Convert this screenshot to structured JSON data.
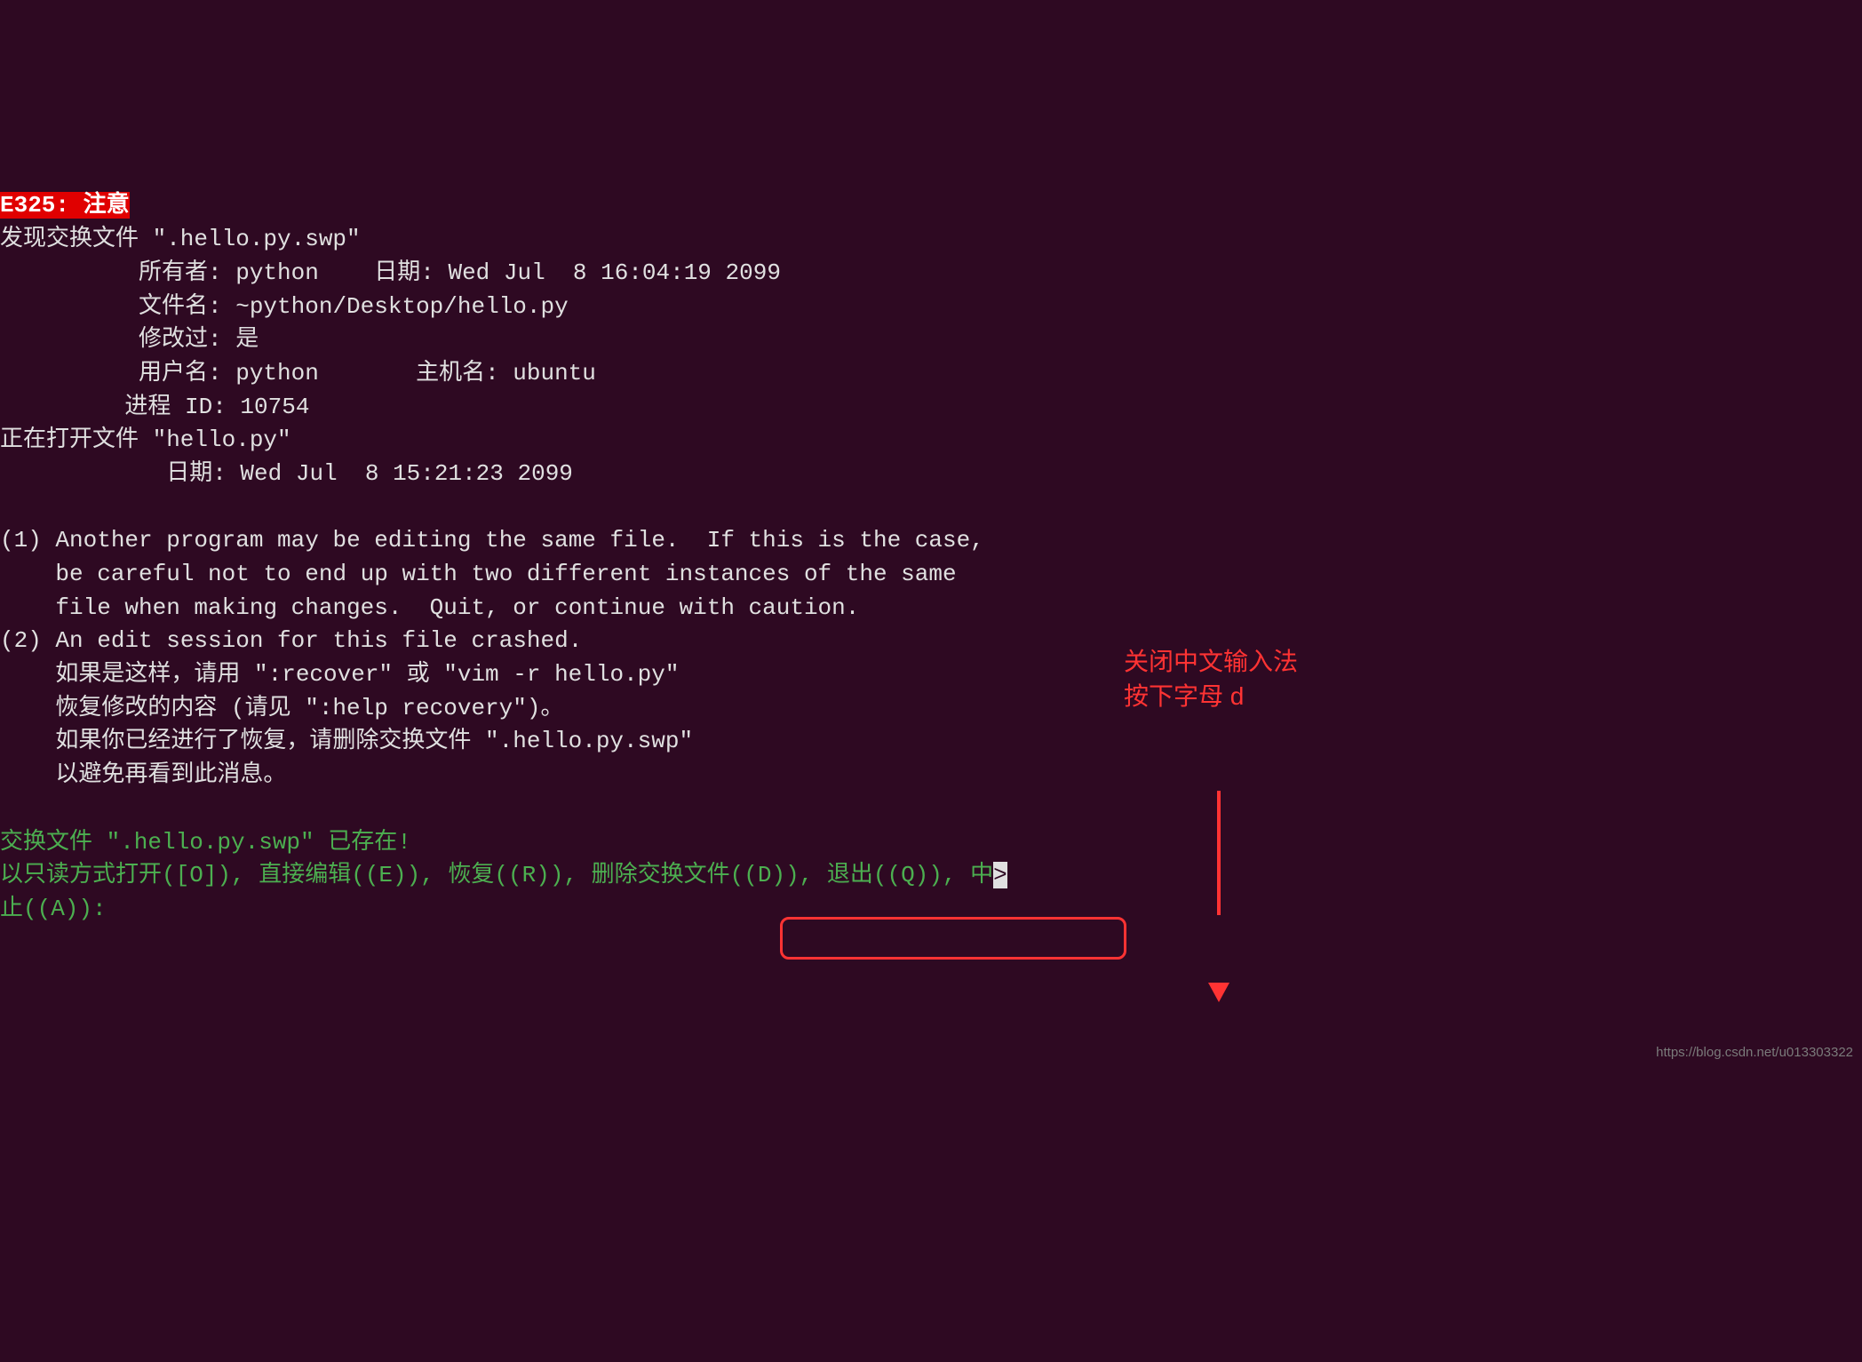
{
  "error_label": "E325: 注意",
  "swap_found": "发现交换文件 \".hello.py.swp\"",
  "owner_label": "          所有者: python    日期: Wed Jul  8 16:04:19 2099",
  "filename_label": "          文件名: ~python/Desktop/hello.py",
  "modified_label": "          修改过: 是",
  "username_label": "          用户名: python       主机名: ubuntu",
  "process_id": "         进程 ID: 10754",
  "opening_file": "正在打开文件 \"hello.py\"",
  "file_date": "            日期: Wed Jul  8 15:21:23 2099",
  "msg1_line1": "(1) Another program may be editing the same file.  If this is the case,",
  "msg1_line2": "    be careful not to end up with two different instances of the same",
  "msg1_line3": "    file when making changes.  Quit, or continue with caution.",
  "msg2_line1": "(2) An edit session for this file crashed.",
  "msg2_line2": "    如果是这样，请用 \":recover\" 或 \"vim -r hello.py\"",
  "msg2_line3": "    恢复修改的内容 (请见 \":help recovery\")。",
  "msg2_line4": "    如果你已经进行了恢复，请删除交换文件 \".hello.py.swp\"",
  "msg2_line5": "    以避免再看到此消息。",
  "swap_exists": "交换文件 \".hello.py.swp\" 已存在!",
  "options_part1": "以只读方式打开([O]), 直接编辑((E)), 恢复((R)), 删除交换文件((D)), 退出((Q)), 中",
  "options_part2": "止((A)): ",
  "continue_char": ">",
  "annotation_line1": "关闭中文输入法",
  "annotation_line2": "按下字母 d",
  "watermark_text": "https://blog.csdn.net/u013303322"
}
